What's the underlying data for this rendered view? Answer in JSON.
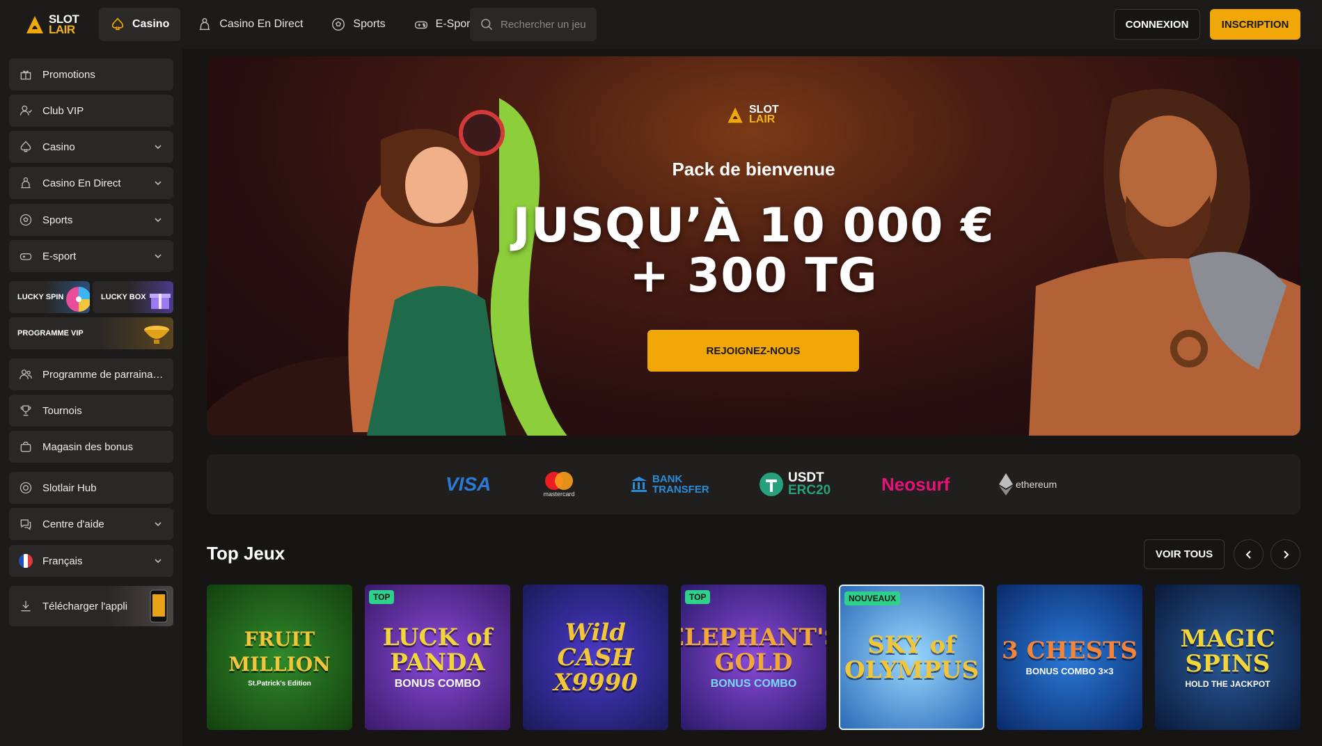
{
  "header": {
    "logo": {
      "line1": "SLOT",
      "line2": "LAIR"
    },
    "nav": [
      {
        "label": "Casino",
        "icon": "spade-icon",
        "active": true
      },
      {
        "label": "Casino En Direct",
        "icon": "dealer-icon",
        "active": false
      },
      {
        "label": "Sports",
        "icon": "soccer-ball-icon",
        "active": false
      },
      {
        "label": "E-Sport",
        "icon": "gamepad-icon",
        "active": false
      }
    ],
    "search": {
      "placeholder": "Rechercher un jeu"
    },
    "login_label": "CONNEXION",
    "signup_label": "INSCRIPTION"
  },
  "sidebar": {
    "items": [
      {
        "label": "Promotions",
        "icon": "gift-icon"
      },
      {
        "label": "Club VIP",
        "icon": "vip-user-icon"
      },
      {
        "label": "Casino",
        "icon": "spade-icon"
      },
      {
        "label": "Casino En Direct",
        "icon": "dealer-icon"
      },
      {
        "label": "Sports",
        "icon": "soccer-ball-icon"
      },
      {
        "label": "E-sport",
        "icon": "gamepad-icon"
      },
      {
        "label": "Programme de parraina…",
        "icon": "users-icon"
      },
      {
        "label": "Tournois",
        "icon": "trophy-icon"
      },
      {
        "label": "Magasin des bonus",
        "icon": "shopping-bag-icon"
      },
      {
        "label": "Slotlair Hub",
        "icon": "hub-icon"
      },
      {
        "label": "Centre d'aide",
        "icon": "chat-help-icon"
      },
      {
        "label": "Français",
        "icon": "flag-fr-icon"
      },
      {
        "label": "Télécharger l'appli",
        "icon": "download-icon"
      }
    ],
    "promos": {
      "lucky_spin": "LUCKY SPIN",
      "lucky_box": "LUCKY BOX",
      "vip_program": "PROGRAMME VIP"
    }
  },
  "hero": {
    "logo": {
      "line1": "SLOT",
      "line2": "LAIR"
    },
    "subtitle": "Pack de bienvenue",
    "title_line1": "JUSQU’À 10 000 €",
    "title_line2": "+ 300 TG",
    "cta": "REJOIGNEZ-NOUS"
  },
  "payments": {
    "visa": "VISA",
    "mastercard": "mastercard",
    "bank_line1": "BANK",
    "bank_line2": "TRANSFER",
    "usdt_line1": "USDT",
    "usdt_line2": "ERC20",
    "neosurf": "Neosurf",
    "ethereum": "ethereum"
  },
  "top_games": {
    "title": "Top Jeux",
    "see_all": "VOIR TOUS",
    "games": [
      {
        "name": "FRUIT MILLION",
        "sub": "St.Patrick's Edition",
        "badge": "",
        "bg": "#1e5a1c"
      },
      {
        "name": "LUCK of PANDA",
        "sub": "BONUS COMBO",
        "badge": "TOP",
        "bg": "#5a2c8a"
      },
      {
        "name": "Wild CASH X9990",
        "sub": "",
        "badge": "",
        "bg": "#2a2a8a"
      },
      {
        "name": "ELEPHANT'S GOLD",
        "sub": "BONUS COMBO",
        "badge": "TOP",
        "bg": "#4a2a8a"
      },
      {
        "name": "SKY of OLYMPUS",
        "sub": "",
        "badge": "NOUVEAUX",
        "bg": "#3a8ac8"
      },
      {
        "name": "3 CHESTS",
        "sub": "BONUS COMBO 3×3",
        "badge": "",
        "bg": "#1a4a9a"
      },
      {
        "name": "MAGIC SPINS",
        "sub": "HOLD THE JACKPOT",
        "badge": "",
        "bg": "#14305a"
      }
    ]
  }
}
